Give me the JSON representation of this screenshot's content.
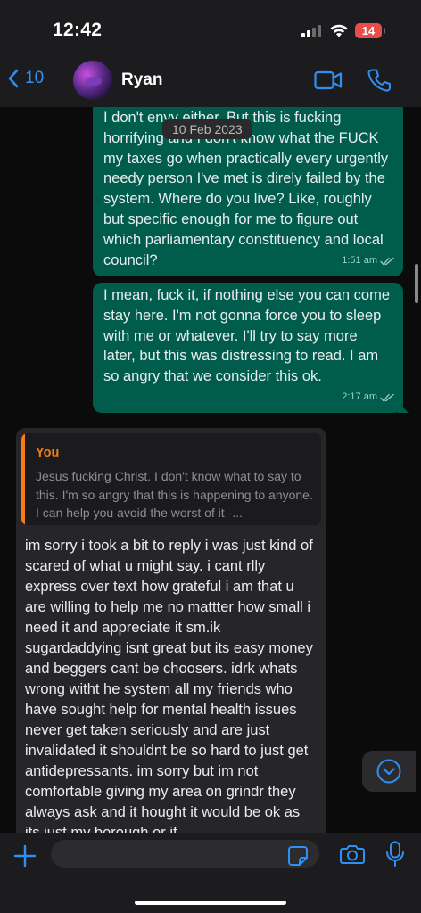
{
  "status_bar": {
    "time": "12:42",
    "battery": "14"
  },
  "header": {
    "back_count": "10",
    "contact_name": "Ryan"
  },
  "chat": {
    "date_label": "10 Feb 2023",
    "messages_out": [
      {
        "text": "I don't envy either. But this is fucking horrifying and I don't know what the FUCK my taxes go when practically every urgently needy person I've met is direly failed by the system. Where do you live? Like, roughly but specific enough for me to figure out which parliamentary constituency and local council?",
        "time": "1:51 am"
      },
      {
        "text": "I mean, fuck it, if nothing else you can come stay here. I'm not gonna force you to sleep with me or whatever. I'll try to say more later, but this was distressing to read. I am so angry that we consider this ok.",
        "time": "2:17 am"
      }
    ],
    "message_in": {
      "quote_author": "You",
      "quote_text": "Jesus fucking Christ. I don't know what to say to this. I'm so angry that this is happening to anyone. I can help you avoid the worst of it -...",
      "text": "im sorry i took a bit to reply i was just kind of scared of what u might say. i cant rlly express over text how grateful i am that u are willing to help me no mattter how small i need it and appreciate it sm.ik sugardaddying isnt great but its easy money and beggers cant be choosers. idrk whats wrong witht he system all my friends who have sought help for mental health issues never get taken seriously and are just invalidated it shouldnt be so hard to just get antidepressants. im sorry but im not comfortable giving my area on grindr they always ask and it hought it would be ok as its just my borough or if"
    }
  },
  "composer": {
    "value": ""
  },
  "colors": {
    "accent": "#2f8ff3",
    "outgoing": "#005c4b",
    "incoming": "#262628",
    "quote_author": "#f57c16"
  }
}
